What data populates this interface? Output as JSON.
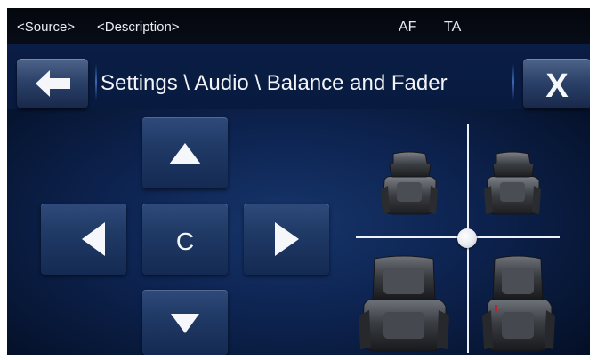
{
  "status": {
    "source": "<Source>",
    "description": "<Description>",
    "af": "AF",
    "ta": "TA"
  },
  "header": {
    "title": "Settings \\ Audio \\ Balance and Fader",
    "back_icon": "arrow-left-icon",
    "close_icon": "close-icon",
    "close_label": "X"
  },
  "dpad": {
    "up_icon": "triangle-up-icon",
    "down_icon": "triangle-down-icon",
    "left_icon": "triangle-left-icon",
    "right_icon": "triangle-right-icon",
    "center_label": "C"
  },
  "balance_map": {
    "balance": 0,
    "fader": 0,
    "seats": [
      "front-left",
      "front-right",
      "rear-left",
      "rear-right"
    ]
  },
  "colors": {
    "background": "#0d2350",
    "button": "#203a66",
    "text": "#f2f4f8"
  }
}
